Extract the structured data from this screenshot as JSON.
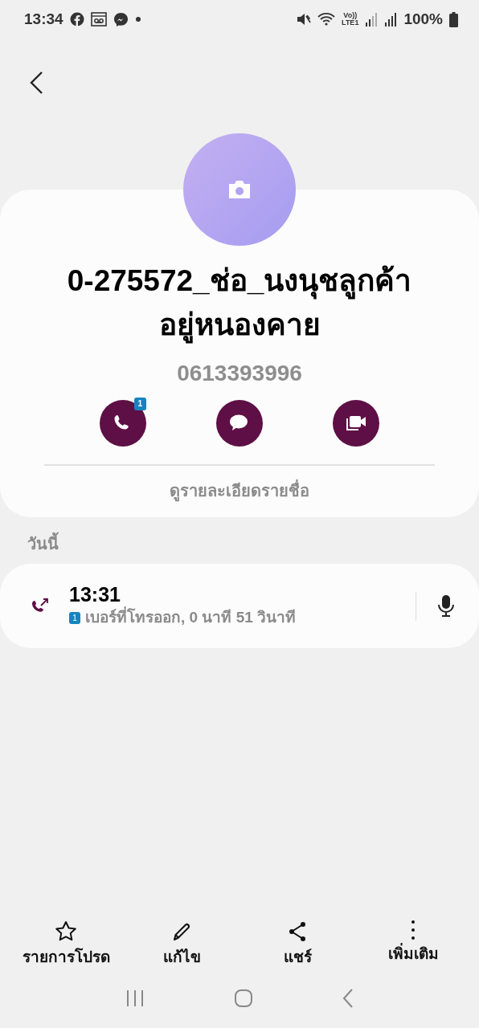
{
  "status_bar": {
    "time": "13:34",
    "volte": "Vo))",
    "network": "LTE1",
    "battery": "100%"
  },
  "contact": {
    "name": "0-275572_ช่อ_นงนุชลูกค้าอยู่หนองคาย",
    "phone": "0613393996"
  },
  "actions": [
    {
      "kind": "call",
      "badge": "1"
    },
    {
      "kind": "message"
    },
    {
      "kind": "video"
    }
  ],
  "details_link": "ดูรายละเอียดรายชื่อ",
  "section_label": "วันนี้",
  "calls": [
    {
      "time": "13:31",
      "sim": "1",
      "description": "เบอร์ที่โทรออก, 0 นาที 51 วินาที"
    }
  ],
  "bottom_actions": [
    {
      "kind": "favorite",
      "label": "รายการโปรด"
    },
    {
      "kind": "edit",
      "label": "แก้ไข"
    },
    {
      "kind": "share",
      "label": "แชร์"
    },
    {
      "kind": "more",
      "label": "เพิ่มเติม"
    }
  ]
}
